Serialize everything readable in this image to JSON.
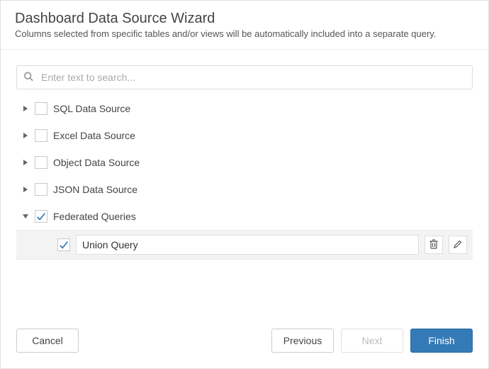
{
  "header": {
    "title": "Dashboard Data Source Wizard",
    "subtitle": "Columns selected from specific tables and/or views will be automatically included into a separate query."
  },
  "search": {
    "placeholder": "Enter text to search..."
  },
  "tree": {
    "nodes": [
      {
        "label": "SQL Data Source",
        "expanded": false,
        "checked": false
      },
      {
        "label": "Excel Data Source",
        "expanded": false,
        "checked": false
      },
      {
        "label": "Object Data Source",
        "expanded": false,
        "checked": false
      },
      {
        "label": "JSON Data Source",
        "expanded": false,
        "checked": false
      },
      {
        "label": "Federated Queries",
        "expanded": true,
        "checked": true
      }
    ],
    "child": {
      "checked": true,
      "value": "Union Query"
    }
  },
  "footer": {
    "cancel": "Cancel",
    "previous": "Previous",
    "next": "Next",
    "finish": "Finish",
    "next_enabled": false
  },
  "colors": {
    "primary": "#337ab7",
    "check": "#337ab7"
  }
}
